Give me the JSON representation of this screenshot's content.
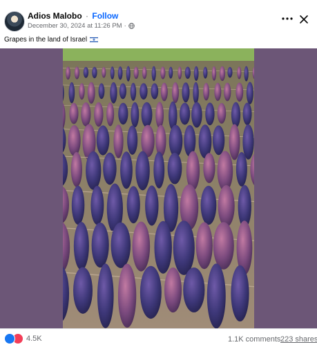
{
  "post": {
    "author": "Adios Malobo",
    "separator": "·",
    "follow_label": "Follow",
    "timestamp": "December 30, 2024 at 11:26 PM",
    "meta_separator": "·",
    "privacy_icon": "globe-icon",
    "caption": "Grapes in the land of Israel",
    "caption_emoji": "israel-flag-icon"
  },
  "header_actions": {
    "more_icon": "more-horizontal-icon",
    "close_icon": "close-icon"
  },
  "media": {
    "type": "video",
    "description_icon": "vineyard-grapes-video",
    "side_color": "#6c5677"
  },
  "footer": {
    "reaction_icons": [
      "like-icon",
      "love-icon"
    ],
    "reactions_count": "4.5K",
    "comments": "1.1K comments",
    "shares": "223 shares"
  },
  "colors": {
    "accent": "#0866ff",
    "like": "#1877f2",
    "love": "#f33e58",
    "secondary_text": "#65676b"
  }
}
